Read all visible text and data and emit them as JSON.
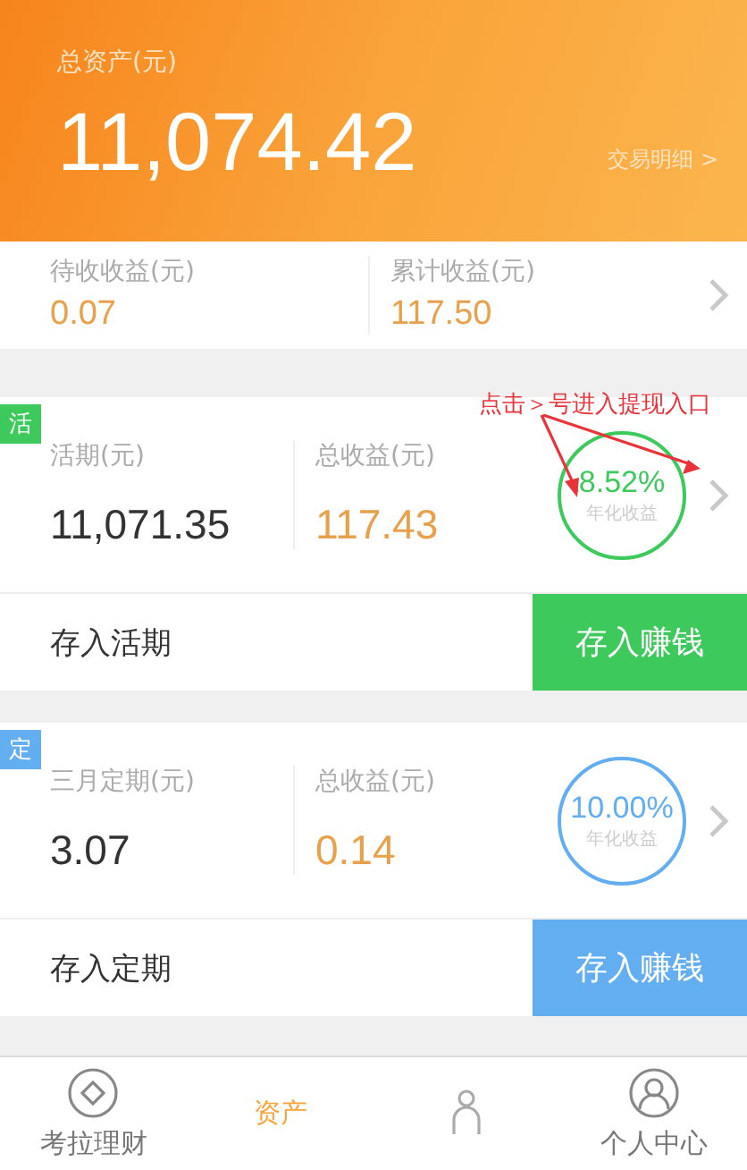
{
  "header": {
    "label": "总资产(元)",
    "total": "11,074.42",
    "link": "交易明细 >"
  },
  "summary": [
    {
      "label": "待收收益(元)",
      "value": "0.07"
    },
    {
      "label": "累计收益(元)",
      "value": "117.50"
    }
  ],
  "annotation": {
    "text": "点击＞号进入提现入口"
  },
  "products": [
    {
      "badge": "活",
      "color": "#3dc95c",
      "label": "活期(元)",
      "value": "11,071.35",
      "income_label": "总收益(元)",
      "income": "117.43",
      "rate": "8.52%",
      "rate_label": "年化收益",
      "action_label": "存入活期",
      "button": "存入赚钱"
    },
    {
      "badge": "定",
      "color": "#62aef0",
      "label": "三月定期(元)",
      "value": "3.07",
      "income_label": "总收益(元)",
      "income": "0.14",
      "rate": "10.00%",
      "rate_label": "年化收益",
      "action_label": "存入定期",
      "button": "存入赚钱"
    }
  ],
  "tabs": [
    {
      "label": "考拉理财",
      "kind": "diamond",
      "selected": false
    },
    {
      "label": "资产",
      "kind": "text",
      "selected": true
    },
    {
      "kind": "person",
      "selected": false
    },
    {
      "label": "个人中心",
      "kind": "user",
      "selected": false
    }
  ]
}
